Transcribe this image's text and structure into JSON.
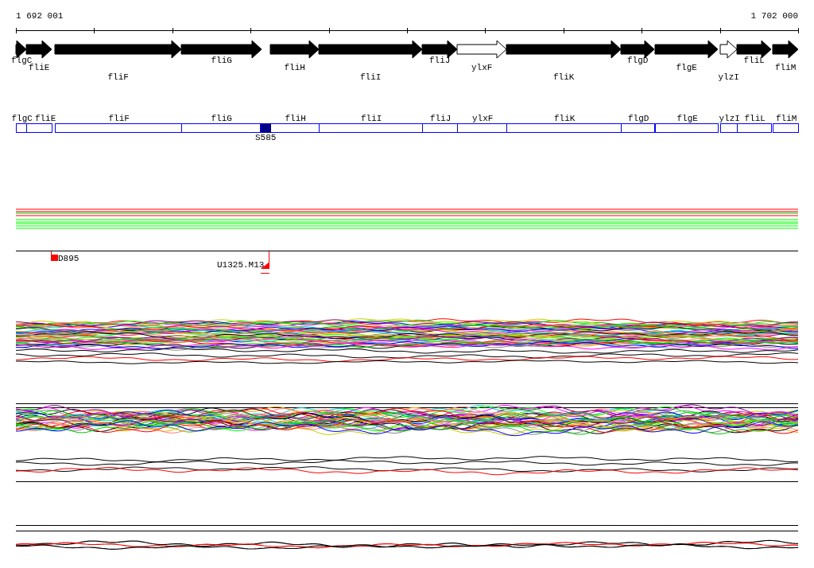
{
  "ruler": {
    "start_label": "1 692 001",
    "end_label": "1 702 000"
  },
  "genes": [
    {
      "name": "flgC",
      "filled": true
    },
    {
      "name": "fliE",
      "filled": true
    },
    {
      "name": "fliF",
      "filled": true
    },
    {
      "name": "fliG",
      "filled": true
    },
    {
      "name": "fliH",
      "filled": true
    },
    {
      "name": "fliI",
      "filled": true
    },
    {
      "name": "fliJ",
      "filled": true
    },
    {
      "name": "ylxF",
      "filled": false
    },
    {
      "name": "fliK",
      "filled": true
    },
    {
      "name": "flgD",
      "filled": true
    },
    {
      "name": "flgE",
      "filled": true
    },
    {
      "name": "ylzI",
      "filled": false
    },
    {
      "name": "fliL",
      "filled": true
    },
    {
      "name": "fliM",
      "filled": true
    }
  ],
  "feature_boxes": [
    "flgC",
    "fliE",
    "fliF",
    "fliG",
    "fliH",
    "fliI",
    "fliJ",
    "ylxF",
    "fliK",
    "flgD",
    "flgE",
    "ylzI",
    "fliL",
    "fliM"
  ],
  "site_marker": {
    "label": "S585"
  },
  "probes": [
    {
      "label": "D895",
      "kind": "square"
    },
    {
      "label": "U1325.M13",
      "kind": "triangle"
    }
  ]
}
